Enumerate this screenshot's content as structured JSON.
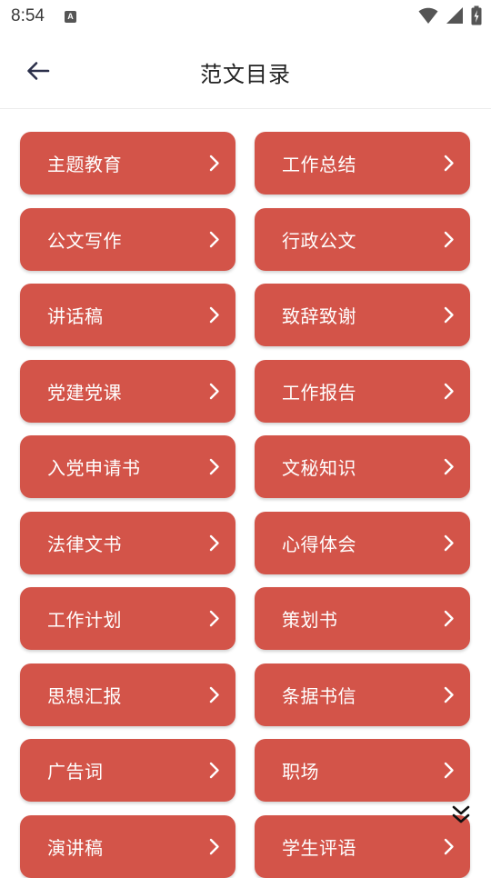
{
  "status_bar": {
    "time": "8:54",
    "notification_icon": "a-icon",
    "icons": [
      "wifi-icon",
      "signal-icon",
      "battery-icon"
    ]
  },
  "header": {
    "title": "范文目录",
    "back_icon": "arrow-left-icon"
  },
  "colors": {
    "card": "#d35449",
    "card_text": "#ffffff",
    "title": "#222222"
  },
  "categories": [
    "主题教育",
    "工作总结",
    "公文写作",
    "行政公文",
    "讲话稿",
    "致辞致谢",
    "党建党课",
    "工作报告",
    "入党申请书",
    "文秘知识",
    "法律文书",
    "心得体会",
    "工作计划",
    "策划书",
    "思想汇报",
    "条据书信",
    "广告词",
    "职场",
    "演讲稿",
    "学生评语"
  ],
  "scroll_icon": "double-chevron-down-icon"
}
